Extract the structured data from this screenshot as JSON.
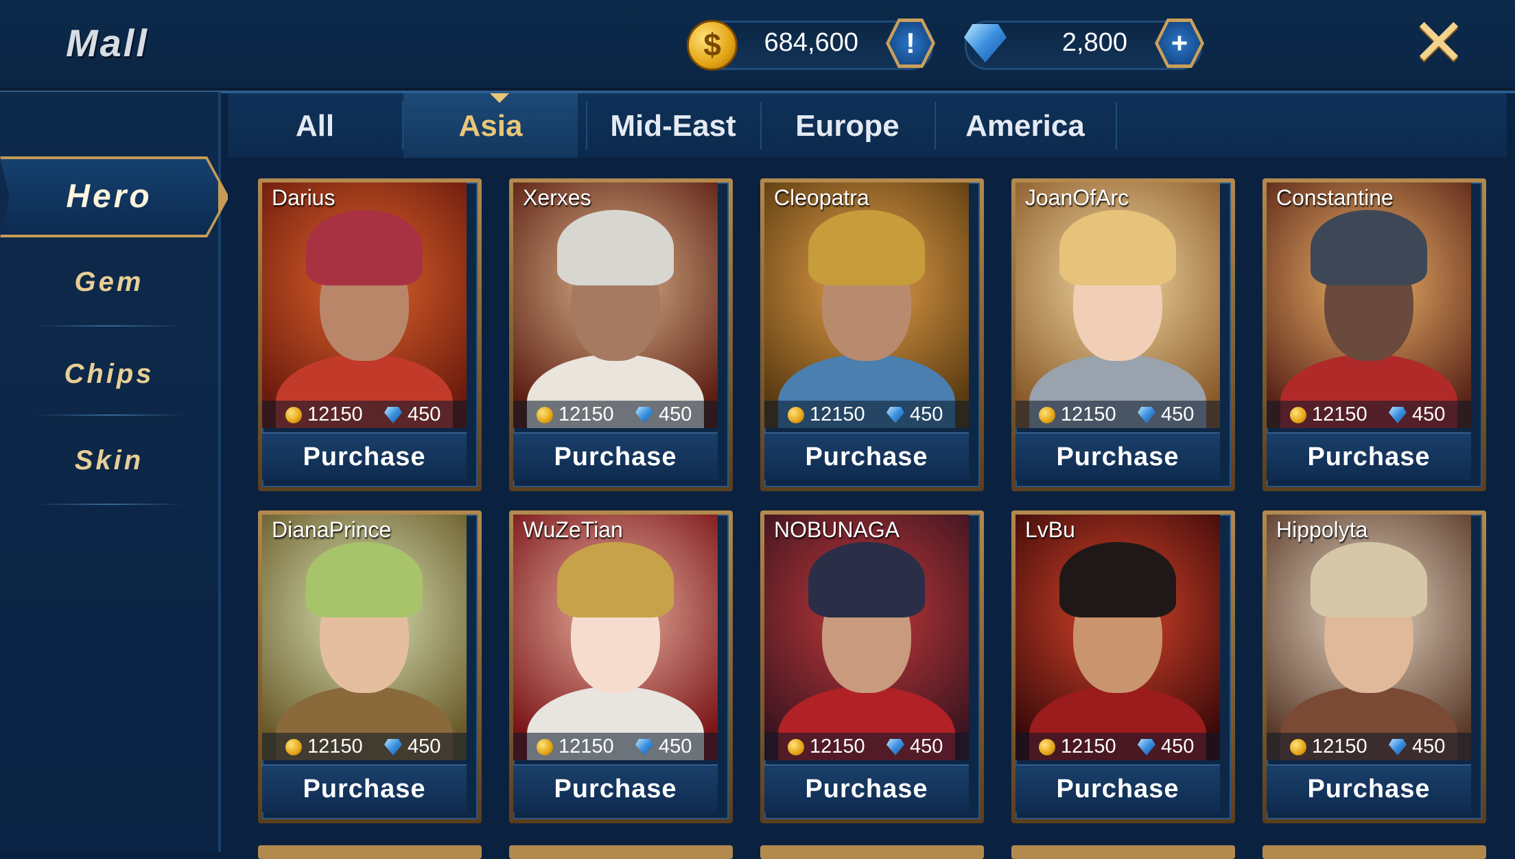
{
  "header": {
    "title": "Mall",
    "gold": {
      "value": "684,600",
      "icon": "gold-coin-icon",
      "action_icon": "exclamation-icon",
      "coin_glyph": "$",
      "action_glyph": "!"
    },
    "gems": {
      "value": "2,800",
      "icon": "gem-icon",
      "action_icon": "plus-icon",
      "action_glyph": "+"
    },
    "close_glyph": "✕"
  },
  "sidebar": {
    "items": [
      {
        "label": "Hero",
        "active": true
      },
      {
        "label": "Gem",
        "active": false
      },
      {
        "label": "Chips",
        "active": false
      },
      {
        "label": "Skin",
        "active": false
      }
    ]
  },
  "tabs": [
    {
      "label": "All",
      "selected": false
    },
    {
      "label": "Asia",
      "selected": true
    },
    {
      "label": "Mid-East",
      "selected": false
    },
    {
      "label": "Europe",
      "selected": false
    },
    {
      "label": "America",
      "selected": false
    }
  ],
  "heroes": [
    {
      "name": "Darius",
      "gold": "12150",
      "gems": "450",
      "button": "Purchase"
    },
    {
      "name": "Xerxes",
      "gold": "12150",
      "gems": "450",
      "button": "Purchase"
    },
    {
      "name": "Cleopatra",
      "gold": "12150",
      "gems": "450",
      "button": "Purchase"
    },
    {
      "name": "JoanOfArc",
      "gold": "12150",
      "gems": "450",
      "button": "Purchase"
    },
    {
      "name": "Constantine",
      "gold": "12150",
      "gems": "450",
      "button": "Purchase"
    },
    {
      "name": "DianaPrince",
      "gold": "12150",
      "gems": "450",
      "button": "Purchase"
    },
    {
      "name": "WuZeTian",
      "gold": "12150",
      "gems": "450",
      "button": "Purchase"
    },
    {
      "name": "NOBUNAGA",
      "gold": "12150",
      "gems": "450",
      "button": "Purchase"
    },
    {
      "name": "LvBu",
      "gold": "12150",
      "gems": "450",
      "button": "Purchase"
    },
    {
      "name": "Hippolyta",
      "gold": "12150",
      "gems": "450",
      "button": "Purchase"
    }
  ],
  "portrait_palettes": [
    {
      "bg": [
        "#e0642b",
        "#6b1a0d"
      ],
      "helm": "#a83242",
      "skin": "#b9866a",
      "body": "#c23a2a"
    },
    {
      "bg": [
        "#d9b48a",
        "#5c1d12"
      ],
      "helm": "#d8d6d0",
      "skin": "#a57a60",
      "body": "#e9e4dc"
    },
    {
      "bg": [
        "#e7a24b",
        "#5a3a10"
      ],
      "helm": "#c79c3b",
      "skin": "#b98b6e",
      "body": "#4a7fb0"
    },
    {
      "bg": [
        "#f2d9a3",
        "#8a5a2a"
      ],
      "helm": "#e6c27a",
      "skin": "#f1cfb6",
      "body": "#9aa3ad"
    },
    {
      "bg": [
        "#f0b66a",
        "#5a2418"
      ],
      "helm": "#3e4756",
      "skin": "#6a4a3c",
      "body": "#b02a2a"
    },
    {
      "bg": [
        "#d9e3b5",
        "#6a5a2a"
      ],
      "helm": "#a7c46a",
      "skin": "#e5bea0",
      "body": "#8a6a3a"
    },
    {
      "bg": [
        "#e9b3a0",
        "#7a1418"
      ],
      "helm": "#c8a24a",
      "skin": "#f6dccf",
      "body": "#e8e4e0"
    },
    {
      "bg": [
        "#c23a3a",
        "#3c1420"
      ],
      "helm": "#2a2e46",
      "skin": "#c99a7e",
      "body": "#b02226"
    },
    {
      "bg": [
        "#d9452a",
        "#3c0a0a"
      ],
      "helm": "#201818",
      "skin": "#c9946e",
      "body": "#9a1c1c"
    },
    {
      "bg": [
        "#e6d6c2",
        "#5a3a2a"
      ],
      "helm": "#d6c7a8",
      "skin": "#e0b89a",
      "body": "#7a4a34"
    }
  ]
}
